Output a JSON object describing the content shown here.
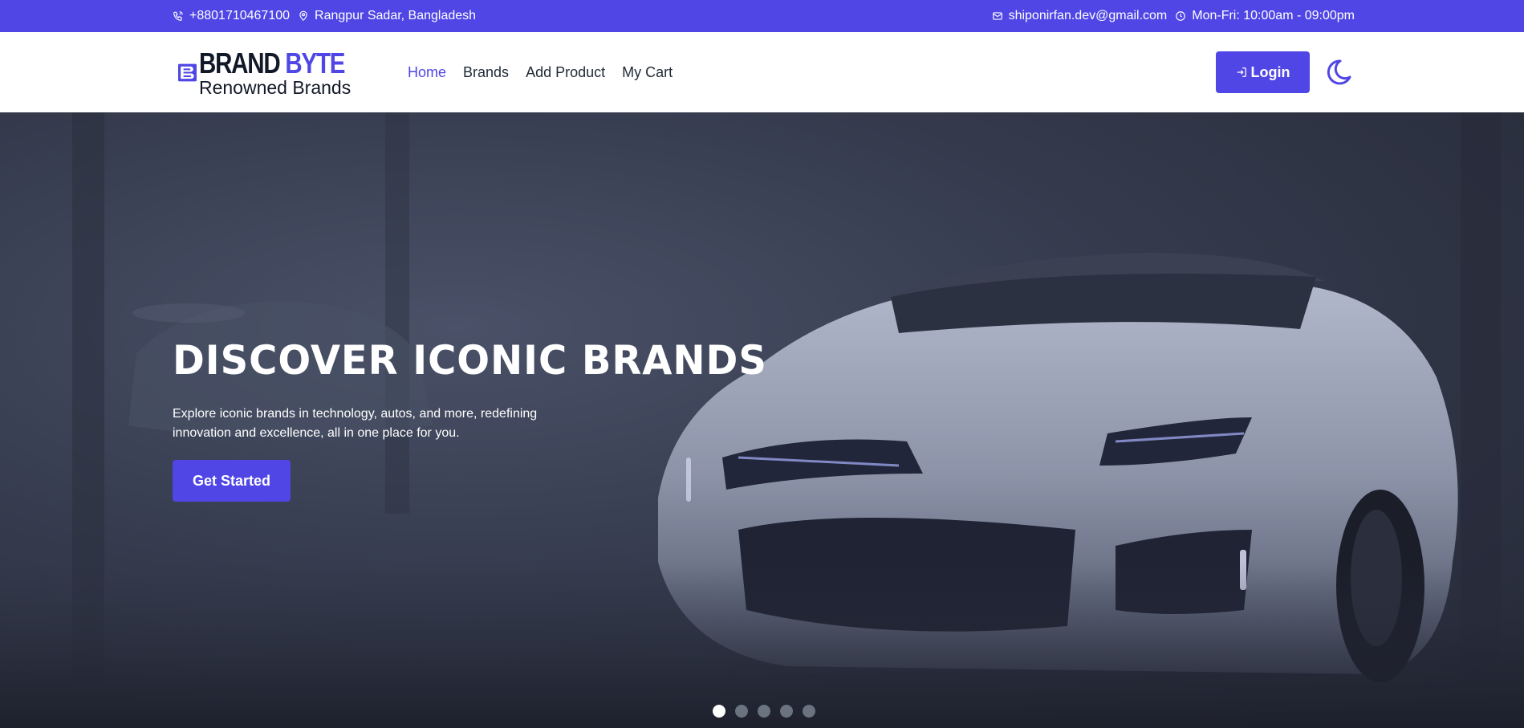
{
  "topbar": {
    "phone": "+8801710467100",
    "location": "Rangpur Sadar, Bangladesh",
    "email": "shiponirfan.dev@gmail.com",
    "hours": "Mon-Fri: 10:00am - 09:00pm",
    "icons": [
      "phone-icon",
      "location-pin-icon",
      "mail-icon",
      "clock-icon"
    ]
  },
  "brand": {
    "title_part1": "BRAND",
    "title_part2": "BYTE",
    "subtitle": "Renowned Brands"
  },
  "nav": {
    "items": [
      {
        "label": "Home",
        "active": true
      },
      {
        "label": "Brands",
        "active": false
      },
      {
        "label": "Add Product",
        "active": false
      },
      {
        "label": "My Cart",
        "active": false
      }
    ],
    "login_label": "Login",
    "theme_icon": "moon-icon"
  },
  "hero": {
    "title": "DISCOVER ICONIC BRANDS",
    "description": "Explore iconic brands in technology, autos, and more, redefining innovation and excellence, all in one place for you.",
    "cta_label": "Get Started",
    "slide_count": 5,
    "active_slide": 1
  },
  "colors": {
    "accent": "#4f46e5",
    "text_dark": "#1f2937",
    "white": "#ffffff"
  }
}
